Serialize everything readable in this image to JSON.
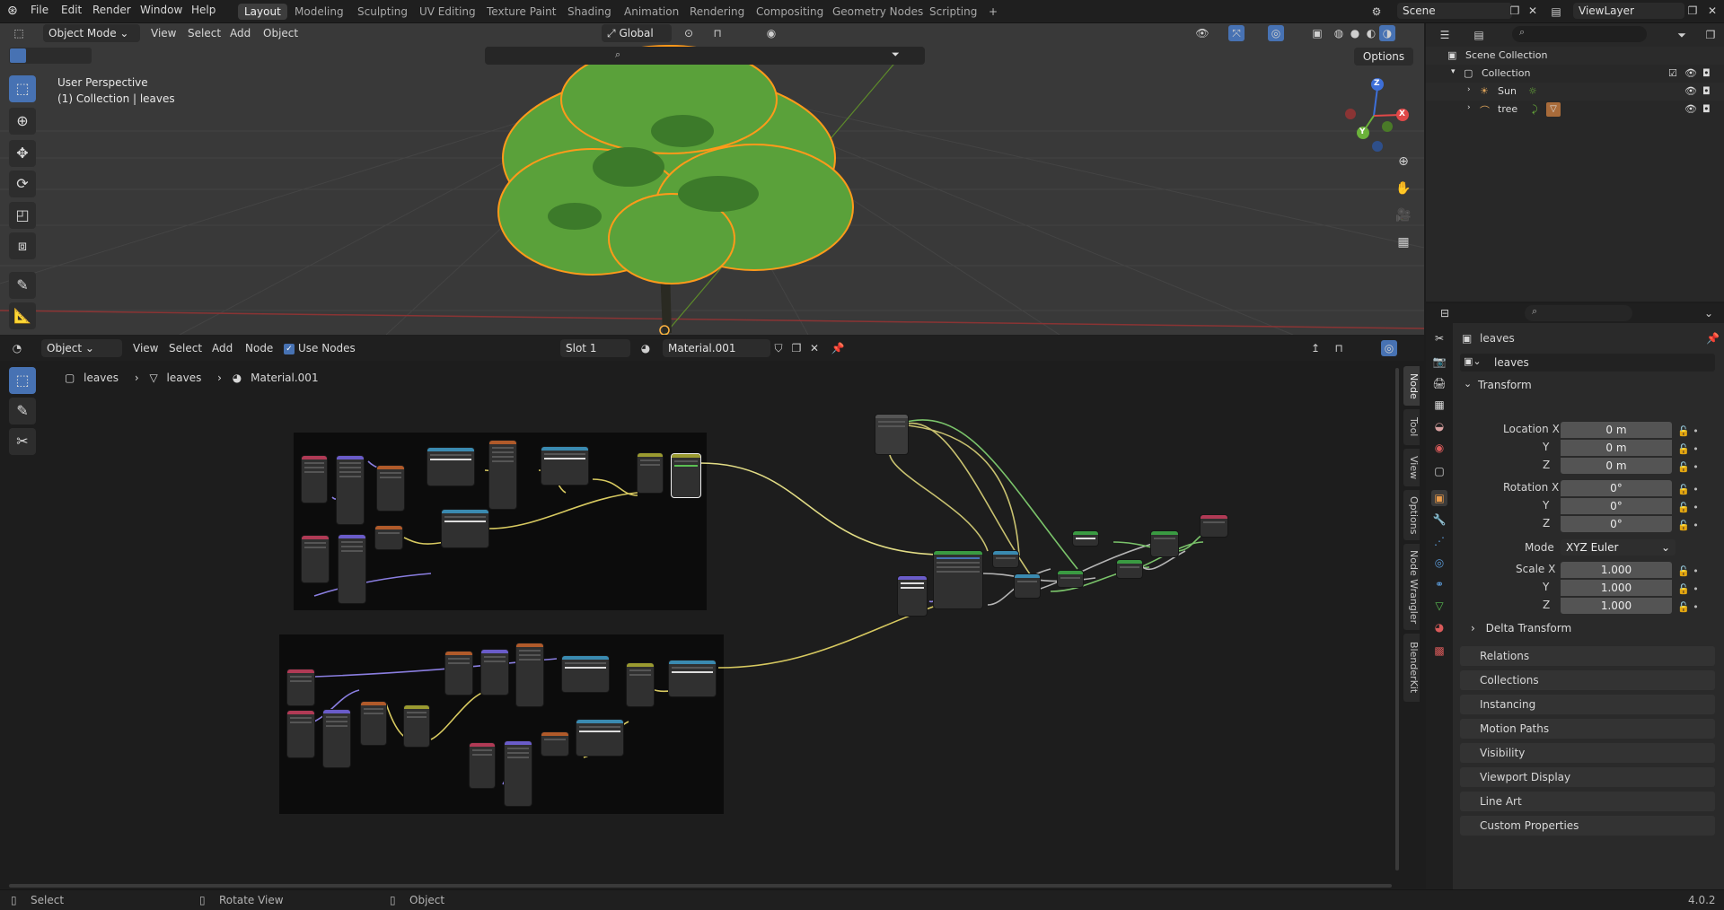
{
  "topbar": {
    "menus": [
      "File",
      "Edit",
      "Render",
      "Window",
      "Help"
    ],
    "workspaces": [
      "Layout",
      "Modeling",
      "Sculpting",
      "UV Editing",
      "Texture Paint",
      "Shading",
      "Animation",
      "Rendering",
      "Compositing",
      "Geometry Nodes",
      "Scripting"
    ],
    "active_workspace": "Layout",
    "scene": "Scene",
    "view_layer": "ViewLayer"
  },
  "viewport": {
    "mode": "Object Mode",
    "menus": [
      "View",
      "Select",
      "Add",
      "Object"
    ],
    "orientation": "Global",
    "options_label": "Options",
    "perspective_label": "User Perspective",
    "collection_label": "(1) Collection | leaves",
    "gizmo_axes": {
      "x": "X",
      "y": "Y",
      "z": "Z"
    }
  },
  "node_editor": {
    "type_label": "Object",
    "menus": [
      "View",
      "Select",
      "Add",
      "Node"
    ],
    "use_nodes_label": "Use Nodes",
    "slot": "Slot 1",
    "material": "Material.001",
    "breadcrumb": [
      "leaves",
      "leaves",
      "Material.001"
    ],
    "sidebar_tabs": [
      "Node",
      "Tool",
      "View",
      "Options",
      "Node Wrangler",
      "BlenderKit"
    ]
  },
  "outliner": {
    "root": "Scene Collection",
    "collection": "Collection",
    "items": [
      "Sun",
      "tree"
    ]
  },
  "properties": {
    "object_name": "leaves",
    "data_name": "leaves",
    "transform_label": "Transform",
    "location_label": "Location X",
    "rotation_label": "Rotation X",
    "scale_label": "Scale X",
    "axis_y": "Y",
    "axis_z": "Z",
    "location": [
      "0 m",
      "0 m",
      "0 m"
    ],
    "rotation": [
      "0°",
      "0°",
      "0°"
    ],
    "mode_label": "Mode",
    "mode_value": "XYZ Euler",
    "scale": [
      "1.000",
      "1.000",
      "1.000"
    ],
    "delta_transform": "Delta Transform",
    "panels": [
      "Relations",
      "Collections",
      "Instancing",
      "Motion Paths",
      "Visibility",
      "Viewport Display",
      "Line Art",
      "Custom Properties"
    ]
  },
  "statusbar": {
    "select": "Select",
    "rotate": "Rotate View",
    "object": "Object",
    "version": "4.0.2"
  }
}
